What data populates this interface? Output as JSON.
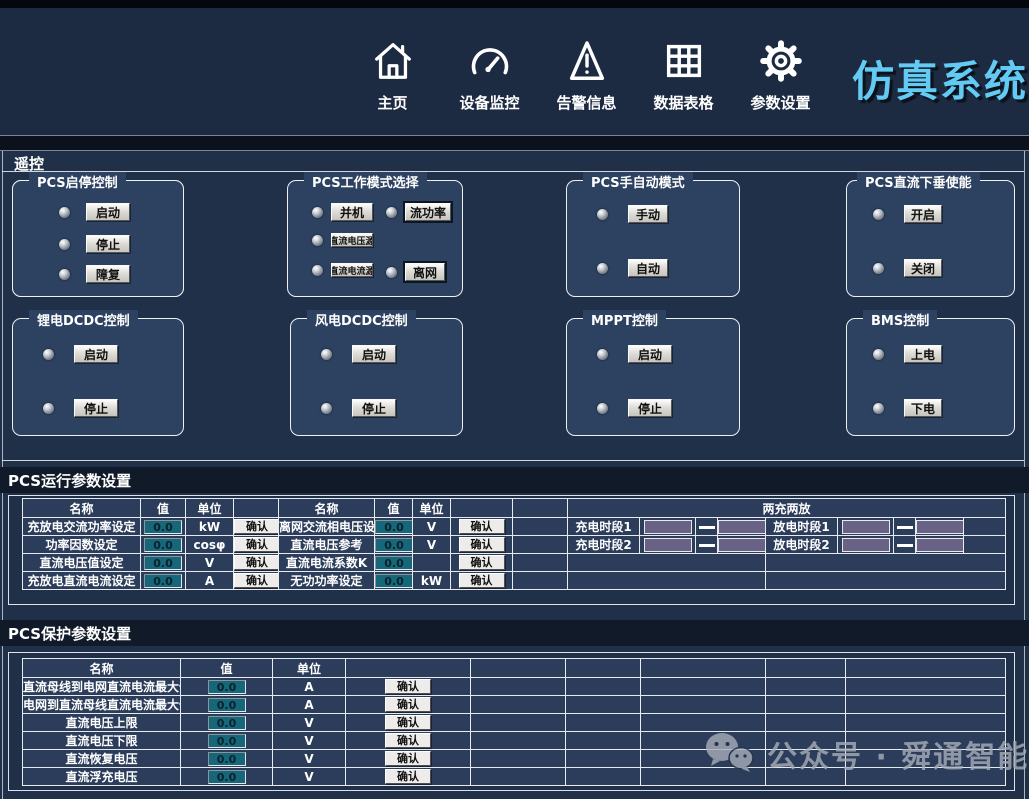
{
  "header": {
    "title": "仿真系统",
    "nav": [
      {
        "label": "主页",
        "icon": "home-icon"
      },
      {
        "label": "设备监控",
        "icon": "gauge-icon"
      },
      {
        "label": "告警信息",
        "icon": "alarm-icon"
      },
      {
        "label": "数据表格",
        "icon": "table-icon"
      },
      {
        "label": "参数设置",
        "icon": "gear-icon"
      }
    ]
  },
  "remote": {
    "title": "遥控",
    "groups": [
      {
        "title": "PCS启停控制",
        "buttons": [
          {
            "label": "启动"
          },
          {
            "label": "停止"
          },
          {
            "label": "障复"
          }
        ]
      },
      {
        "title": "PCS工作模式选择",
        "buttons": [
          {
            "label": "并机"
          },
          {
            "label": "流功率"
          },
          {
            "label": "直流电压源"
          },
          {
            "label": "直流电流源"
          },
          {
            "label": "离网"
          }
        ]
      },
      {
        "title": "PCS手自动模式",
        "buttons": [
          {
            "label": "手动"
          },
          {
            "label": "自动"
          }
        ]
      },
      {
        "title": "PCS直流下垂使能",
        "buttons": [
          {
            "label": "开启"
          },
          {
            "label": "关闭"
          }
        ]
      },
      {
        "title": "锂电DCDC控制",
        "buttons": [
          {
            "label": "启动"
          },
          {
            "label": "停止"
          }
        ]
      },
      {
        "title": "风电DCDC控制",
        "buttons": [
          {
            "label": "启动"
          },
          {
            "label": "停止"
          }
        ]
      },
      {
        "title": "MPPT控制",
        "buttons": [
          {
            "label": "启动"
          },
          {
            "label": "停止"
          }
        ]
      },
      {
        "title": "BMS控制",
        "buttons": [
          {
            "label": "上电"
          },
          {
            "label": "下电"
          }
        ]
      }
    ]
  },
  "run_params": {
    "title": "PCS运行参数设置",
    "col_headers": {
      "name": "名称",
      "value": "值",
      "unit": "单位"
    },
    "confirm_label": "确认",
    "left_rows": [
      {
        "name": "充放电交流功率设定",
        "value": "0.0",
        "unit": "kW"
      },
      {
        "name": "功率因数设定",
        "value": "0.0",
        "unit": "cosφ"
      },
      {
        "name": "直流电压值设定",
        "value": "0.0",
        "unit": "V"
      },
      {
        "name": "充放电直流电流设定",
        "value": "0.0",
        "unit": "A"
      }
    ],
    "right_rows": [
      {
        "name": "离网交流相电压设定",
        "value": "0.0",
        "unit": "V"
      },
      {
        "name": "直流电压参考",
        "value": "0.0",
        "unit": "V"
      },
      {
        "name": "直流电流系数K",
        "value": "0.0",
        "unit": ""
      },
      {
        "name": "无功功率设定",
        "value": "0.0",
        "unit": "kW"
      }
    ],
    "schedule": {
      "title": "两充两放",
      "rows": [
        {
          "charge": "充电时段1",
          "discharge": "放电时段1"
        },
        {
          "charge": "充电时段2",
          "discharge": "放电时段2"
        }
      ]
    }
  },
  "protect_params": {
    "title": "PCS保护参数设置",
    "col_headers": {
      "name": "名称",
      "value": "值",
      "unit": "单位"
    },
    "confirm_label": "确认",
    "rows": [
      {
        "name": "直流母线到电网直流电流最大值",
        "value": "0.0",
        "unit": "A"
      },
      {
        "name": "电网到直流母线直流电流最大值",
        "value": "0.0",
        "unit": "A"
      },
      {
        "name": "直流电压上限",
        "value": "0.0",
        "unit": "V"
      },
      {
        "name": "直流电压下限",
        "value": "0.0",
        "unit": "V"
      },
      {
        "name": "直流恢复电压",
        "value": "0.0",
        "unit": "V"
      },
      {
        "name": "直流浮充电压",
        "value": "0.0",
        "unit": "V"
      }
    ]
  },
  "watermark": {
    "text": "公众号 · 舜通智能"
  },
  "colors": {
    "title_accent": "#63caf3",
    "unit_text": "#cdd93f",
    "value_box_bg": "#17677b",
    "time_box_bg": "#696287",
    "header_bg": "#1c2b42",
    "content_bg": "#203048",
    "groupbox_bg": "#2d4160"
  }
}
